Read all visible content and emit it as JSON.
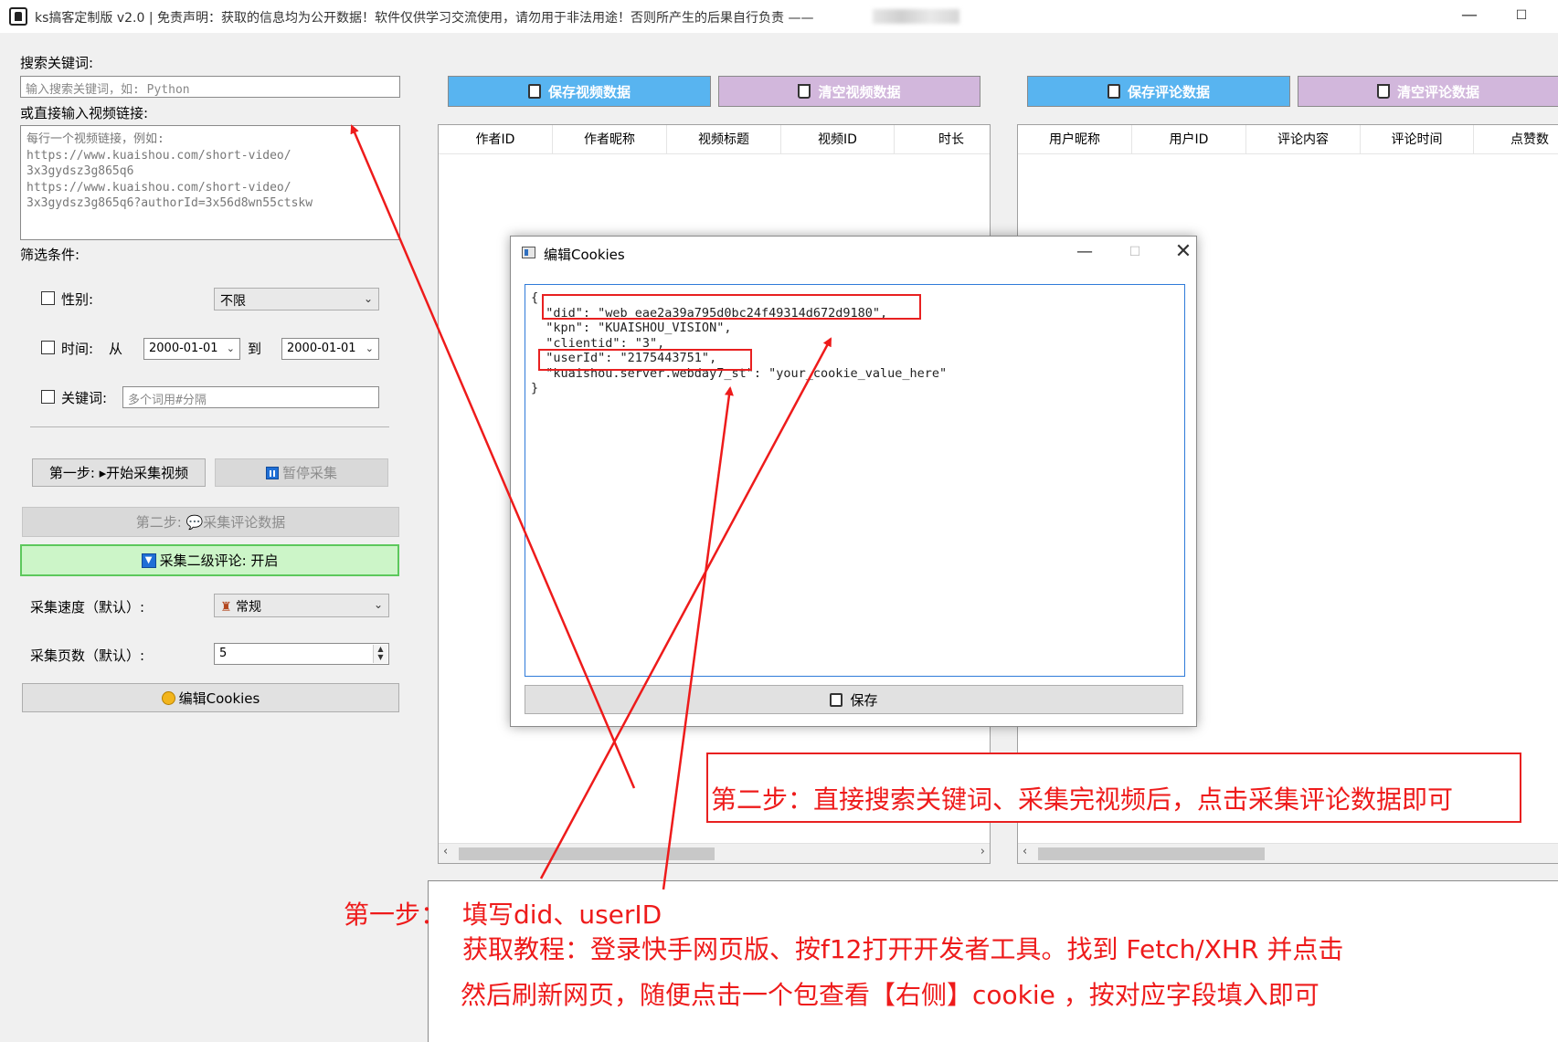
{
  "window": {
    "title": "ks搞客定制版 v2.0 | 免责声明：获取的信息均为公开数据！软件仅供学习交流使用，请勿用于非法用途！否则所产生的后果自行负责 ——",
    "minimize_glyph": "—",
    "maximize_glyph": "☐"
  },
  "left_panel": {
    "search_label": "搜索关键词:",
    "search_placeholder": "输入搜索关键词，如: Python",
    "links_label": "或直接输入视频链接:",
    "links_placeholder": "每行一个视频链接，例如:\nhttps://www.kuaishou.com/short-video/\n3x3gydsz3g865q6\nhttps://www.kuaishou.com/short-video/\n3x3gydsz3g865q6?authorId=3x56d8wn55ctskw",
    "filter_label": "筛选条件:",
    "gender_label": "性别:",
    "gender_value": "不限",
    "time_label": "时间:",
    "from_label": "从",
    "from_date": "2000-01-01",
    "to_label": "到",
    "to_date": "2000-01-01",
    "keyword_label": "关键词:",
    "keyword_placeholder": "多个词用#分隔",
    "step1_button": "第一步: ▸开始采集视频",
    "pause_button": "暂停采集",
    "step2_button": "第二步: 💬采集评论数据",
    "level2_button": "采集二级评论: 开启",
    "speed_label": "采集速度（默认）:",
    "speed_value": "常规",
    "pages_label": "采集页数（默认）:",
    "pages_value": "5",
    "cookies_button": "编辑Cookies"
  },
  "video_panel": {
    "save_button": "保存视频数据",
    "clear_button": "清空视频数据",
    "columns": [
      "作者ID",
      "作者昵称",
      "视频标题",
      "视频ID",
      "时长"
    ]
  },
  "comment_panel": {
    "save_button": "保存评论数据",
    "clear_button": "清空评论数据",
    "columns": [
      "用户昵称",
      "用户ID",
      "评论内容",
      "评论时间",
      "点赞数"
    ]
  },
  "dialog": {
    "title": "编辑Cookies",
    "json_text": "{\n  \"did\": \"web_eae2a39a795d0bc24f49314d672d9180\",\n  \"kpn\": \"KUAISHOU_VISION\",\n  \"clientid\": \"3\",\n  \"userId\": \"2175443751\",\n  \"kuaishou.server.webday7_st\": \"your_cookie_value_here\"\n}",
    "save_button": "保存"
  },
  "annotations": {
    "step2_note": "第二步：直接搜索关键词、采集完视频后，点击采集评论数据即可",
    "step1_label": "第一步：",
    "step1_line1": "填写did、userID",
    "step1_line2": "获取教程：登录快手网页版、按f12打开开发者工具。找到 Fetch/XHR 并点击",
    "step1_line3": "然后刷新网页，随便点击一个包查看【右侧】cookie ，按对应字段填入即可",
    "accent_color": "#ee1b1b"
  }
}
